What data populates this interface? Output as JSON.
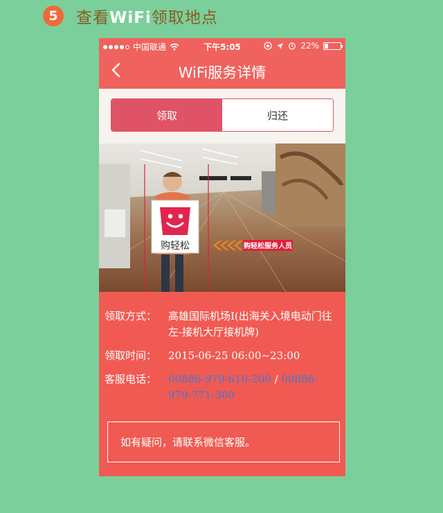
{
  "step": {
    "number": "5",
    "title_prefix": "查看",
    "title_highlight": "WiFi",
    "title_suffix": "领取地点"
  },
  "status_bar": {
    "carrier": "中国联通",
    "time": "下午5:05",
    "battery": "22%"
  },
  "nav": {
    "back_icon": "chevron-left-icon",
    "title": "WiFi服务详情"
  },
  "tabs": [
    {
      "label": "领取",
      "active": true
    },
    {
      "label": "归还",
      "active": false
    }
  ],
  "photo": {
    "logo_text": "购轻松",
    "sign_text": "购轻松服务人员"
  },
  "details": {
    "method_label": "领取方式：",
    "method_value": "高雄国际机场I(出海关入境电动门往左-接机大厅接机牌)",
    "time_label": "领取时间：",
    "time_value": "2015-06-25 06:00~23:00",
    "phone_label": "客服电话：",
    "phone_1": "00886-979-616-200",
    "phone_separator": " / ",
    "phone_2": "00886-979-771-300"
  },
  "notice": "如有疑问，请联系微信客服。",
  "colors": {
    "background": "#7bcf9a",
    "primary": "#f0625d",
    "tab_active": "#e05266",
    "link": "#4178d6",
    "step_badge": "#ef6a3b"
  }
}
